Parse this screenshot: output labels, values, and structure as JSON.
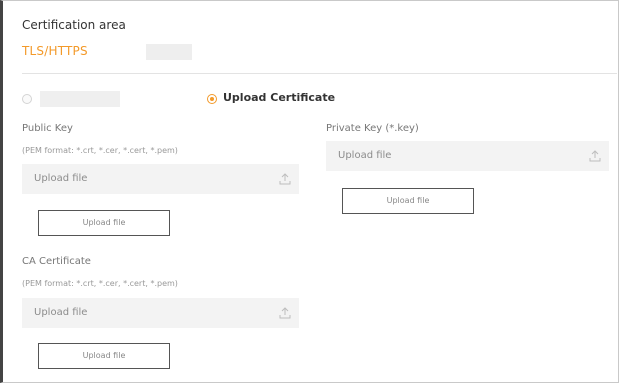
{
  "certification": {
    "area_title": "Certification area",
    "tabs": [
      {
        "label": "TLS/HTTPS",
        "active": true
      },
      {
        "label": "",
        "active": false
      }
    ],
    "mode": {
      "options": [
        {
          "label": "",
          "selected": false
        },
        {
          "label": "Upload Certificate",
          "selected": true
        }
      ]
    },
    "public_key": {
      "label": "Public Key",
      "hint": "(PEM format: *.crt, *.cer, *.cert, *.pem)",
      "placeholder": "Upload file",
      "button": "Upload file"
    },
    "private_key": {
      "label": "Private Key (*.key)",
      "placeholder": "Upload file",
      "button": "Upload file"
    },
    "ca_certificate": {
      "label": "CA Certificate",
      "hint": "(PEM format: *.crt, *.cer, *.cert, *.pem)",
      "placeholder": "Upload file",
      "button": "Upload file"
    },
    "colors": {
      "accent": "#f39a2a",
      "field_bg": "#f3f3f3",
      "border": "#c9c9c9"
    },
    "icons": [
      "upload-icon"
    ]
  }
}
